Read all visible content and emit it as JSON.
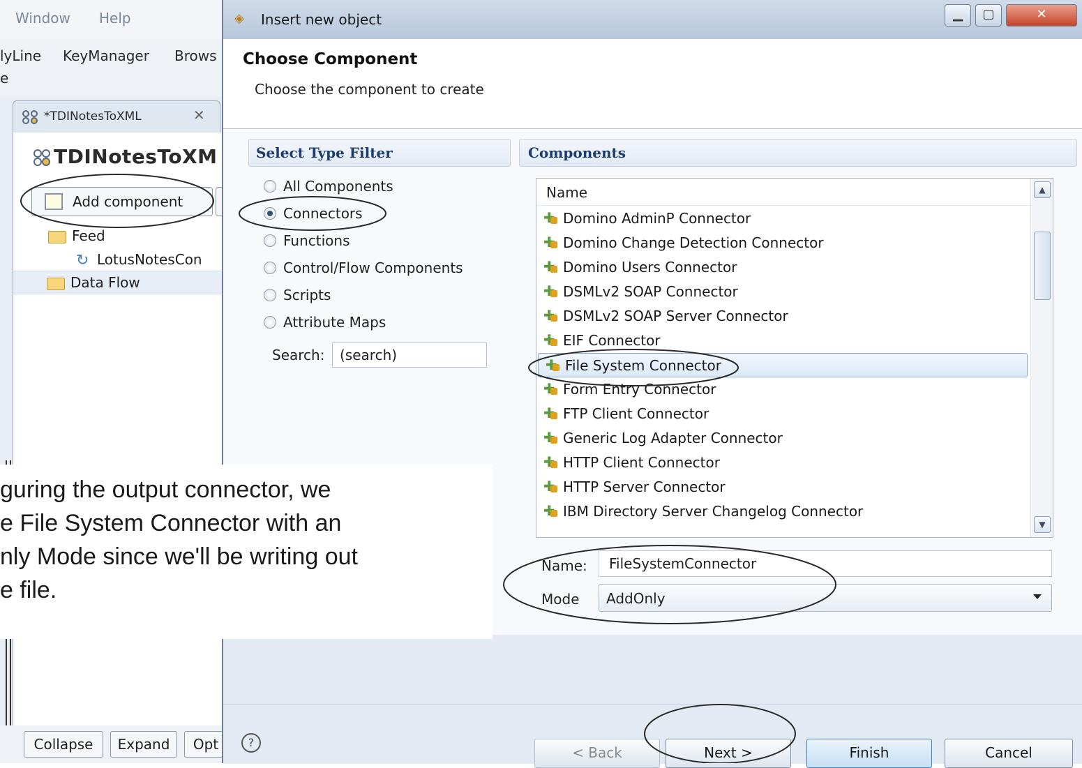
{
  "background_ide": {
    "menubar": [
      "Window",
      "Help"
    ],
    "toolbar": [
      "lyLine",
      "KeyManager",
      "Brows"
    ],
    "toolbar_fragment": "e",
    "editor_tab_label": "*TDINotesToXML",
    "editor_title": "TDINotesToXM",
    "add_component_label": "Add component",
    "tree": [
      {
        "label": "Feed",
        "icon": "folder-icon"
      },
      {
        "label": "LotusNotesCon",
        "icon": "refresh-icon"
      },
      {
        "label": "Data Flow",
        "icon": "folder-icon"
      }
    ],
    "bottom_buttons": [
      "Collapse",
      "Expand",
      "Opt"
    ]
  },
  "dialog": {
    "title": "Insert new object",
    "heading": "Choose Component",
    "subheading": "Choose the component to create",
    "filter": {
      "header": "Select Type Filter",
      "options": [
        "All Components",
        "Connectors",
        "Functions",
        "Control/Flow Components",
        "Scripts",
        "Attribute Maps"
      ],
      "selected": "Connectors",
      "search_label": "Search:",
      "search_value": "(search)"
    },
    "components": {
      "header": "Components",
      "column_header": "Name",
      "items": [
        "Domino AdminP Connector",
        "Domino Change Detection Connector",
        "Domino Users Connector",
        "DSMLv2 SOAP Connector",
        "DSMLv2 SOAP Server Connector",
        "EIF Connector",
        "File System Connector",
        "Form Entry Connector",
        "FTP Client Connector",
        "Generic Log Adapter Connector",
        "HTTP Client Connector",
        "HTTP Server Connector",
        "IBM Directory Server Changelog Connector"
      ],
      "selected": "File System Connector"
    },
    "name_label": "Name:",
    "name_value": "FileSystemConnector",
    "mode_label": "Mode",
    "mode_value": "AddOnly",
    "buttons": {
      "back": "< Back",
      "next": "Next >",
      "finish": "Finish",
      "cancel": "Cancel"
    }
  },
  "caption": {
    "lines": [
      "guring the output connector, we",
      "e File System Connector with an",
      "nly Mode since we'll be writing out",
      "e file."
    ]
  },
  "colors": {
    "dialog_bg": "#e3eaf3",
    "header_text": "#1c3d6e",
    "selection": "#dce9f8",
    "annotation_ring": "#2a2a2a"
  }
}
